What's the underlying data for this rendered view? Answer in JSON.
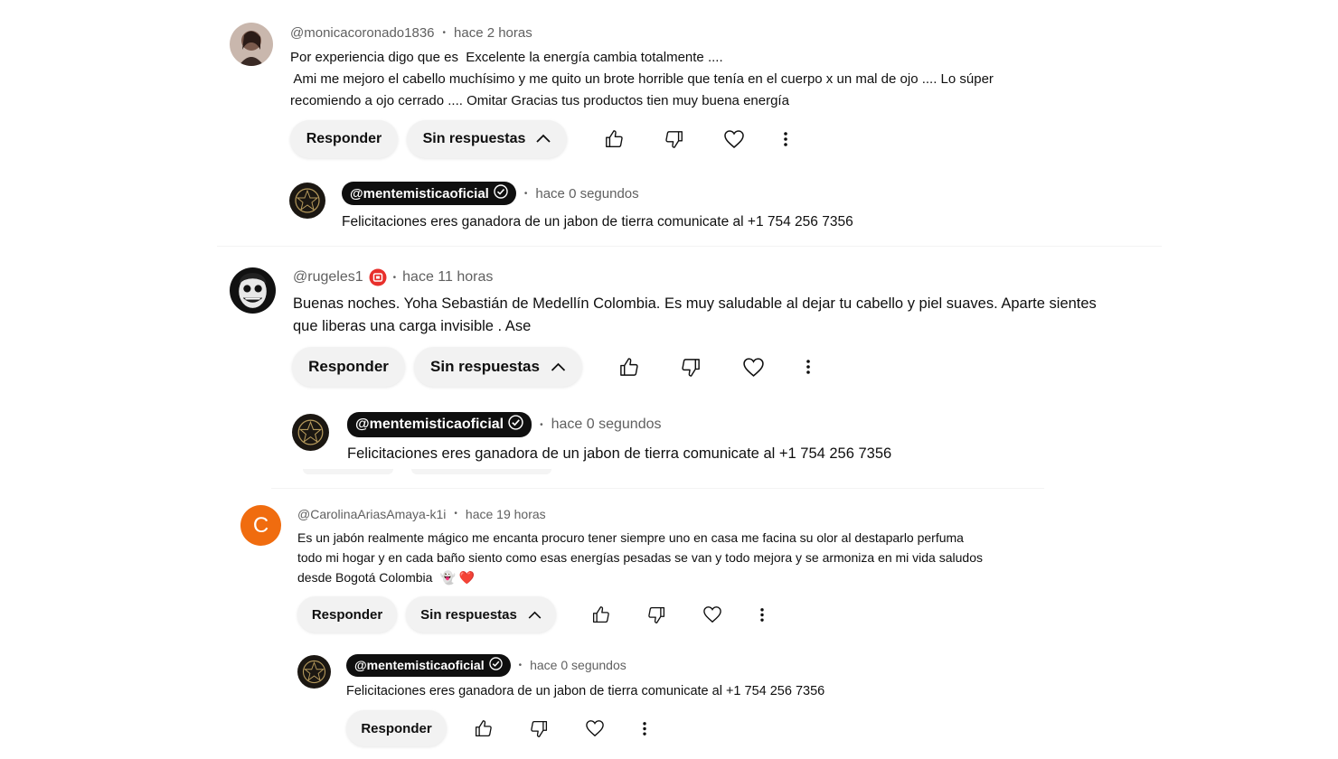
{
  "comments": [
    {
      "author": "@monicacoronado1836",
      "time": "hace 2 horas",
      "lines": [
        "Por experiencia digo que es  Excelente la energía cambia totalmente ....",
        " Ami me mejoro el cabello muchísimo y me quito un brote horrible que tenía en el cuerpo x un mal de ojo .... Lo súper",
        "recomiendo a ojo cerrado .... Omitar Gracias tus productos tien muy buena energía"
      ],
      "reply_label": "Responder",
      "replies_label": "Sin respuestas",
      "reply": {
        "author": "@mentemisticaoficial",
        "time": "hace 0 segundos",
        "text": "Felicitaciones eres ganadora de un jabon de tierra comunicate al +1 754 256 7356"
      }
    },
    {
      "author": "@rugeles1",
      "time": "hace 11 horas",
      "lines": [
        "Buenas noches. Yoha Sebastián de Medellín Colombia. Es muy saludable al dejar tu cabello y piel suaves. Aparte sientes",
        "que liberas una carga invisible . Ase"
      ],
      "reply_label": "Responder",
      "replies_label": "Sin respuestas",
      "reply": {
        "author": "@mentemisticaoficial",
        "time": "hace 0 segundos",
        "text": "Felicitaciones eres ganadora de un jabon de tierra comunicate al +1 754 256 7356"
      }
    },
    {
      "author": "@CarolinaAriasAmaya-k1i",
      "avatar_letter": "C",
      "time": "hace 19 horas",
      "lines": [
        "Es un jabón realmente mágico me encanta procuro tener siempre uno en casa me facina su olor al destaparlo perfuma",
        "todo mi hogar y en cada baño siento como esas energías pesadas se van y todo mejora y se armoniza en mi vida saludos",
        "desde Bogotá Colombia"
      ],
      "emoji": "👻 ❤️",
      "reply_label": "Responder",
      "replies_label": "Sin respuestas",
      "reply": {
        "author": "@mentemisticaoficial",
        "time": "hace 0 segundos",
        "text": "Felicitaciones eres ganadora de un jabon de tierra comunicate al +1 754 256 7356",
        "reply_label": "Responder"
      }
    }
  ],
  "icons": [
    "like-icon",
    "dislike-icon",
    "heart-icon",
    "more-vert-icon",
    "chevron-up-icon",
    "verified-check-icon",
    "badge-icon"
  ],
  "colors": {
    "pill_bg": "#f2f2f2",
    "handle_bg": "#0f0f0f",
    "meta_text": "#606060",
    "orange_avatar": "#f06c0f",
    "badge_red": "#e8302c"
  }
}
